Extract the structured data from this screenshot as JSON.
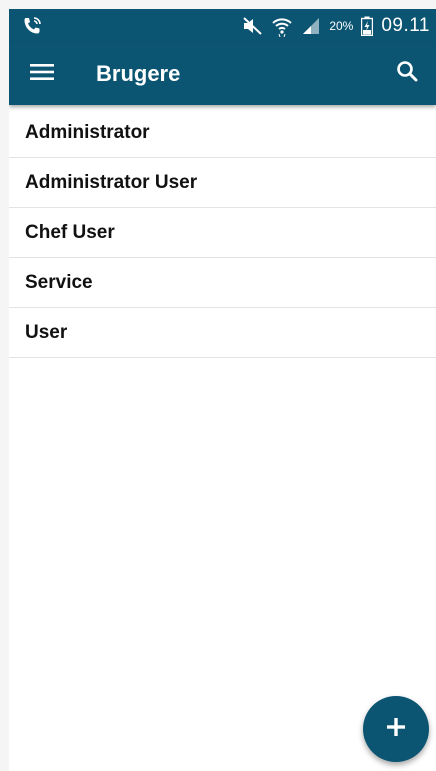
{
  "status_bar": {
    "battery": "20%",
    "time": "09.11"
  },
  "app_bar": {
    "title": "Brugere"
  },
  "users": [
    {
      "name": "Administrator"
    },
    {
      "name": "Administrator User"
    },
    {
      "name": "Chef User"
    },
    {
      "name": "Service"
    },
    {
      "name": "User"
    }
  ],
  "icons": {
    "call": "phone-call-icon",
    "mute": "mute-icon",
    "wifi": "wifi-icon",
    "signal": "signal-icon",
    "battery": "battery-charging-icon",
    "menu": "menu-icon",
    "search": "search-icon",
    "add": "plus-icon"
  },
  "colors": {
    "primary": "#0b5573",
    "on_primary": "#ffffff",
    "divider": "#e3e3e3"
  }
}
